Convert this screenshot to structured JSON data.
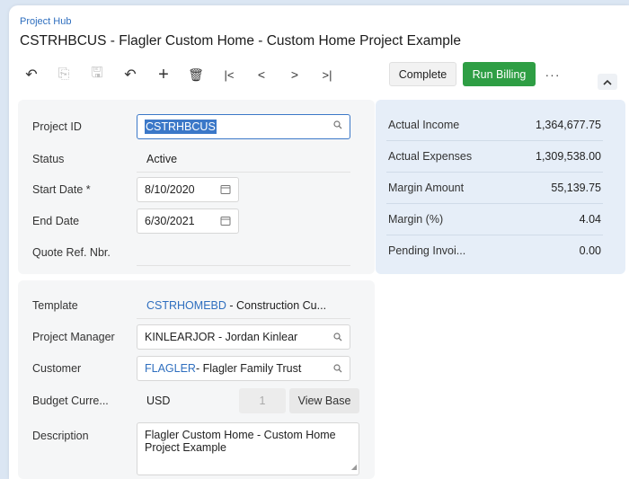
{
  "header": {
    "breadcrumb": "Project Hub",
    "title": "CSTRHBCUS - Flagler Custom Home - Custom Home Project Example"
  },
  "toolbar": {
    "back_icon": "↶",
    "copy_icon": "⎘",
    "save_icon": "🖫",
    "undo_icon": "↶",
    "add_icon": "+",
    "delete_icon": "🗑",
    "first_icon": "|<",
    "prev_icon": "<",
    "next_icon": ">",
    "last_icon": ">|",
    "complete_label": "Complete",
    "run_billing_label": "Run Billing",
    "more_label": "···",
    "collapse_icon": "^",
    "run_billing_color": "#2e9e44"
  },
  "summary": {
    "project_id_label": "Project ID",
    "project_id_value": "CSTRHBCUS",
    "status_label": "Status",
    "status_value": "Active",
    "start_date_label": "Start Date *",
    "start_date_value": "8/10/2020",
    "end_date_label": "End Date",
    "end_date_value": "6/30/2021",
    "quote_label": "Quote Ref. Nbr.",
    "quote_value": ""
  },
  "financials": [
    {
      "label": "Actual Income",
      "value": "1,364,677.75"
    },
    {
      "label": "Actual Expenses",
      "value": "1,309,538.00"
    },
    {
      "label": "Margin Amount",
      "value": "55,139.75"
    },
    {
      "label": "Margin (%)",
      "value": "4.04"
    },
    {
      "label": "Pending Invoi...",
      "value": "0.00"
    }
  ],
  "details": {
    "template_label": "Template",
    "template_code": "CSTRHOMEBD",
    "template_desc": " - Construction Cu...",
    "pm_label": "Project Manager",
    "pm_value": "KINLEARJOR - Jordan Kinlear",
    "customer_label": "Customer",
    "customer_code": "FLAGLER",
    "customer_desc": " - Flagler Family Trust",
    "currency_label": "Budget Curre...",
    "currency_value": "USD",
    "rate_value": "1",
    "view_base_label": "View Base",
    "description_label": "Description",
    "description_value": "Flagler Custom Home - Custom Home Project Example"
  }
}
